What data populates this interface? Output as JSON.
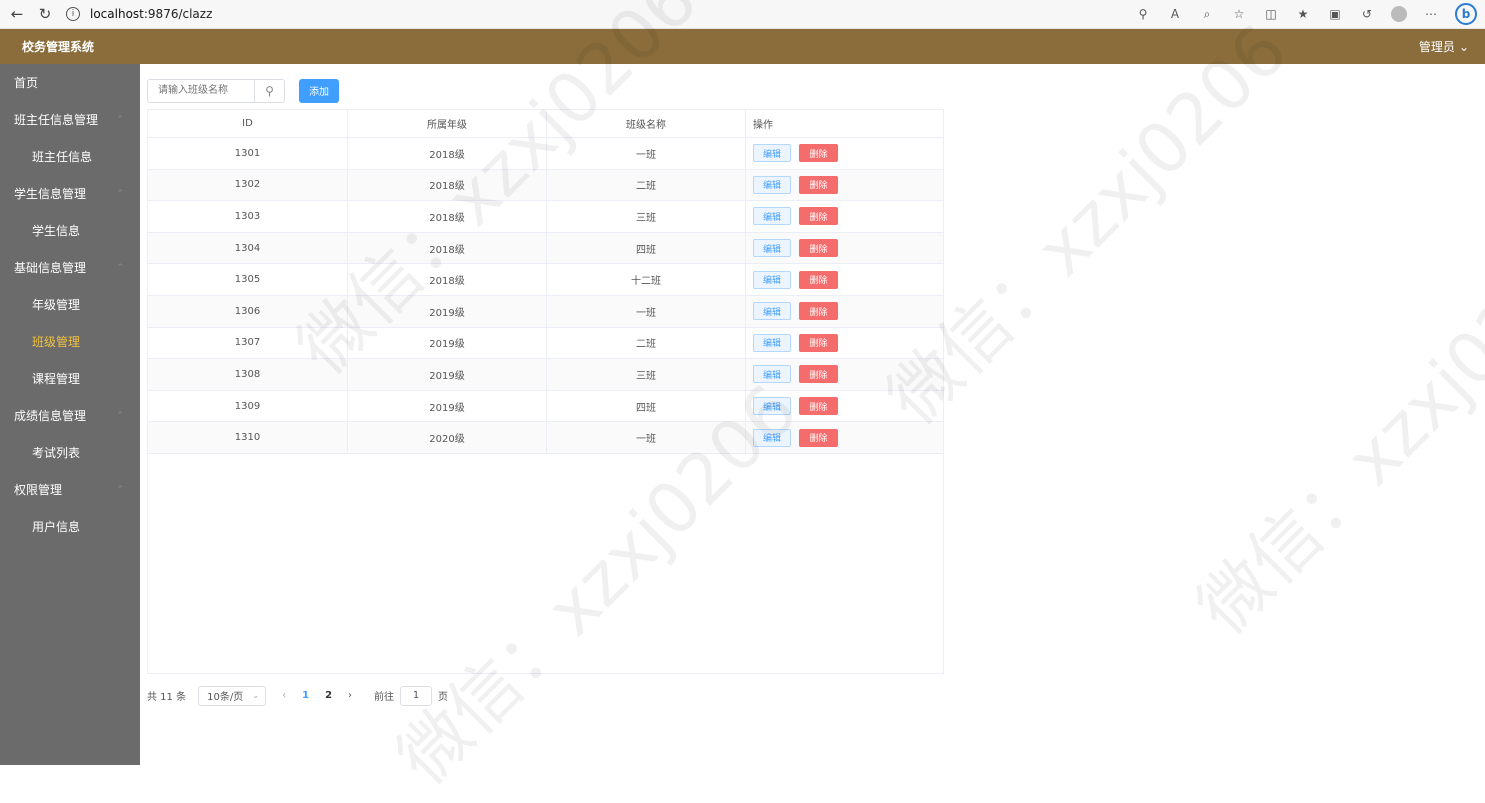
{
  "browser": {
    "url_host": "localhost",
    "url_path": ":9876/clazz"
  },
  "header": {
    "app_title": "校务管理系统",
    "user_label": "管理员"
  },
  "sidebar": {
    "items": [
      {
        "label": "首页",
        "type": "top"
      },
      {
        "label": "班主任信息管理",
        "type": "group"
      },
      {
        "label": "班主任信息",
        "type": "sub"
      },
      {
        "label": "学生信息管理",
        "type": "group"
      },
      {
        "label": "学生信息",
        "type": "sub"
      },
      {
        "label": "基础信息管理",
        "type": "group"
      },
      {
        "label": "年级管理",
        "type": "sub"
      },
      {
        "label": "班级管理",
        "type": "sub",
        "active": true
      },
      {
        "label": "课程管理",
        "type": "sub"
      },
      {
        "label": "成绩信息管理",
        "type": "group"
      },
      {
        "label": "考试列表",
        "type": "sub"
      },
      {
        "label": "权限管理",
        "type": "group"
      },
      {
        "label": "用户信息",
        "type": "sub"
      }
    ]
  },
  "toolbar": {
    "search_placeholder": "请输入班级名称",
    "add_label": "添加"
  },
  "table": {
    "columns": [
      "ID",
      "所属年级",
      "班级名称",
      "操作"
    ],
    "edit_label": "编辑",
    "delete_label": "删除",
    "rows": [
      {
        "id": "1301",
        "grade": "2018级",
        "name": "一班"
      },
      {
        "id": "1302",
        "grade": "2018级",
        "name": "二班"
      },
      {
        "id": "1303",
        "grade": "2018级",
        "name": "三班"
      },
      {
        "id": "1304",
        "grade": "2018级",
        "name": "四班"
      },
      {
        "id": "1305",
        "grade": "2018级",
        "name": "十二班"
      },
      {
        "id": "1306",
        "grade": "2019级",
        "name": "一班"
      },
      {
        "id": "1307",
        "grade": "2019级",
        "name": "二班"
      },
      {
        "id": "1308",
        "grade": "2019级",
        "name": "三班"
      },
      {
        "id": "1309",
        "grade": "2019级",
        "name": "四班"
      },
      {
        "id": "1310",
        "grade": "2020级",
        "name": "一班"
      }
    ]
  },
  "pagination": {
    "total_text": "共 11 条",
    "page_size": "10条/页",
    "pages": [
      "1",
      "2"
    ],
    "goto_label": "前往",
    "goto_value": "1",
    "page_unit": "页"
  },
  "watermark": "微信：xzxj0206"
}
